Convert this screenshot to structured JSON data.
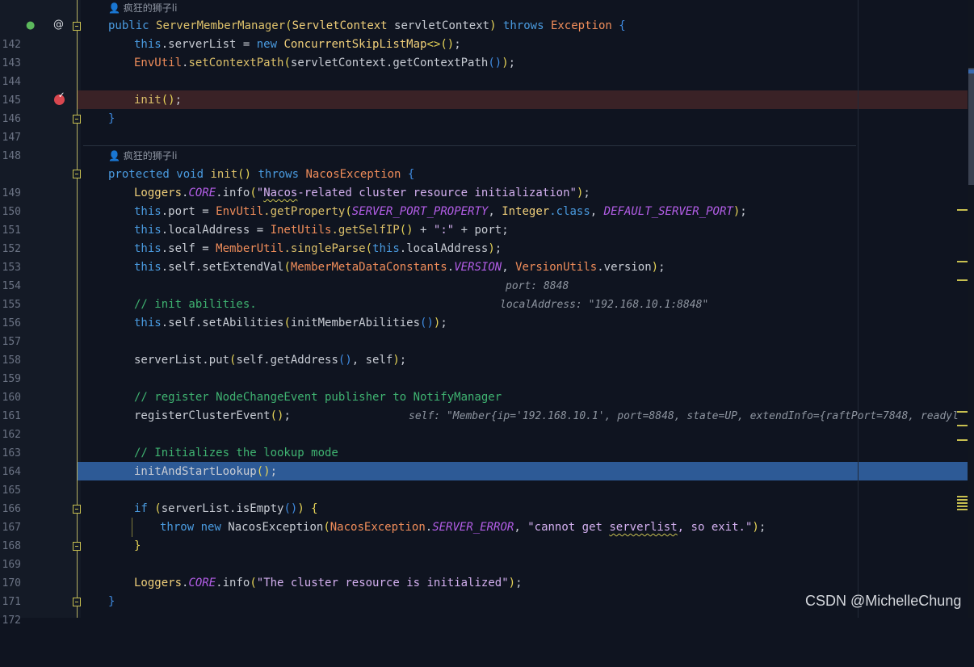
{
  "authors": {
    "a1": "疯狂的狮子li",
    "a2": "疯狂的狮子li"
  },
  "lines": {
    "l142": "142",
    "l143": "143",
    "l144": "144",
    "l145": "145",
    "l146": "146",
    "l147": "147",
    "l148": "148",
    "l149": "149",
    "l150": "150",
    "l151": "151",
    "l152": "152",
    "l153": "153",
    "l154": "154",
    "l155": "155",
    "l156": "156",
    "l157": "157",
    "l158": "158",
    "l159": "159",
    "l160": "160",
    "l161": "161",
    "l162": "162",
    "l163": "163",
    "l164": "164",
    "l165": "165",
    "l166": "166",
    "l167": "167",
    "l168": "168",
    "l169": "169",
    "l170": "170",
    "l171": "171",
    "l172": "172"
  },
  "code": {
    "c142": {
      "kw": "public ",
      "name": "ServerMemberManager",
      "p1": "(",
      "type": "ServletContext",
      "arg": " servletContext",
      "p2": ")",
      "throws": " throws ",
      "exc": "Exception",
      "brace": " {"
    },
    "c143": {
      "this": "this",
      "rest": ".serverList = ",
      "new": "new ",
      "cls": "ConcurrentSkipListMap",
      "gen": "<>()",
      "end": ";"
    },
    "c144": {
      "cls": "EnvUtil",
      "dot": ".",
      "m": "setContextPath",
      "p1": "(",
      "obj": "servletContext.getContextPath",
      "p2": "()",
      "p3": ")",
      "end": ";"
    },
    "c146": {
      "m": "init",
      "p": "()",
      "end": ";"
    },
    "c147": {
      "brace": "}"
    },
    "c149": {
      "kw": "protected ",
      "void": "void ",
      "name": "init",
      "p": "() ",
      "throws": "throws ",
      "exc": "NacosException",
      "brace": " {"
    },
    "c150": {
      "cls": "Loggers",
      "dot": ".",
      "const": "CORE",
      "m": ".info",
      "p1": "(",
      "q1": "\"",
      "squig": "Nacos",
      "str": "-related cluster resource initialization\"",
      "p2": ")",
      "end": ";"
    },
    "c151": {
      "this": "this",
      "a": ".port = ",
      "cls": "EnvUtil",
      "m": ".getProperty",
      "p1": "(",
      "c1": "SERVER_PORT_PROPERTY",
      "sep": ", ",
      "cls2": "Integer",
      "k": ".class",
      "sep2": ", ",
      "c2": "DEFAULT_SERVER_PORT",
      "p2": ")",
      "end": ";"
    },
    "c152": {
      "this": "this",
      "a": ".localAddress = ",
      "cls": "InetUtils",
      "m": ".getSelfIP",
      "p": "()",
      "plus": " + ",
      "str": "\":\"",
      "rest": " + port;",
      "hint": "port: 8848"
    },
    "c153": {
      "this": "this",
      "a": ".self = ",
      "cls": "MemberUtil",
      "m": ".singleParse",
      "p1": "(",
      "this2": "this",
      "b": ".localAddress",
      "p2": ")",
      "end": ";",
      "hint": "localAddress: \"192.168.10.1:8848\""
    },
    "c154": {
      "this": "this",
      "a": ".self.setExtendVal",
      "p1": "(",
      "cls": "MemberMetaDataConstants",
      "dot": ".",
      "const": "VERSION",
      "sep": ", ",
      "cls2": "VersionUtils",
      "rest": ".version",
      "p2": ")",
      "end": ";"
    },
    "c156": {
      "com": "// init abilities."
    },
    "c157": {
      "this": "this",
      "a": ".self.setAbilities",
      "p1": "(",
      "m": "initMemberAbilities",
      "p2": "()",
      "p3": ")",
      "end": ";"
    },
    "c159": {
      "a": "serverList.put",
      "p1": "(",
      "b": "self.getAddress",
      "p2": "()",
      "rest": ", self",
      "p3": ")",
      "end": ";",
      "hint": "self: \"Member{ip='192.168.10.1', port=8848, state=UP, extendInfo={raftPort=7848, readyl"
    },
    "c161": {
      "com": "// register NodeChangeEvent publisher to NotifyManager"
    },
    "c162": {
      "m": "registerClusterEvent",
      "p": "()",
      "end": ";"
    },
    "c164": {
      "com": "// Initializes the lookup mode"
    },
    "c165": {
      "m": "initAndStartLookup",
      "p": "()",
      "end": ";"
    },
    "c167": {
      "kw": "if ",
      "p1": "(",
      "a": "serverList.isEmpty",
      "p2": "()",
      "p3": ")",
      "brace": " {"
    },
    "c168": {
      "throw": "throw ",
      "new": "new ",
      "cls": "NacosException",
      "p1": "(",
      "cls2": "NacosException",
      "dot": ".",
      "const": "SERVER_ERROR",
      "sep": ", ",
      "str1": "\"cannot get ",
      "squig": "serverlist",
      "str2": ", so exit.\"",
      "p2": ")",
      "end": ";"
    },
    "c169": {
      "brace": "}"
    },
    "c171": {
      "cls": "Loggers",
      "dot": ".",
      "const": "CORE",
      "m": ".info",
      "p1": "(",
      "str": "\"The cluster resource is initialized\"",
      "p2": ")",
      "end": ";"
    },
    "c172": {
      "brace": "}"
    }
  },
  "watermark": "CSDN @MichelleChung",
  "gutter_icons": {
    "at": "@"
  },
  "colors": {
    "background": "#0f1420",
    "breakpoint": "#d8474f",
    "selection": "#2d5a96",
    "comment": "#3fb371",
    "keyword": "#4a9be0"
  }
}
